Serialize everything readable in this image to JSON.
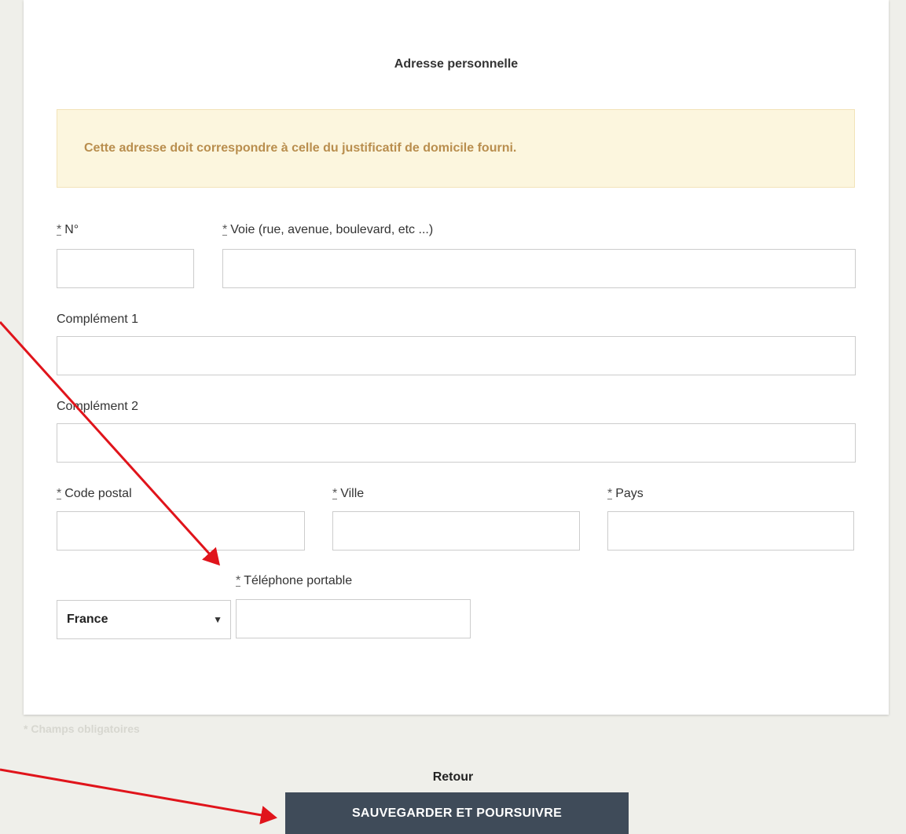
{
  "section": {
    "title": "Adresse personnelle",
    "alert_text": "Cette adresse doit correspondre à celle du justificatif de domicile fourni."
  },
  "fields": {
    "numero": {
      "label": "N°",
      "required": "*",
      "value": ""
    },
    "voie": {
      "label": "Voie (rue, avenue, boulevard, etc ...)",
      "required": "*",
      "value": ""
    },
    "complement1": {
      "label": "Complément 1",
      "value": ""
    },
    "complement2": {
      "label": "Complément 2",
      "value": ""
    },
    "code_postal": {
      "label": "Code postal",
      "required": "*",
      "value": ""
    },
    "ville": {
      "label": "Ville",
      "required": "*",
      "value": ""
    },
    "pays": {
      "label": "Pays",
      "required": "*",
      "value": ""
    },
    "telephone": {
      "label": "Téléphone portable",
      "required": "*",
      "value": ""
    },
    "country_code": {
      "selected": "France"
    }
  },
  "footer": {
    "required_note": "* Champs obligatoires",
    "back_label": "Retour",
    "submit_label": "SAUVEGARDER ET POURSUIVRE"
  },
  "colors": {
    "annotation_arrow": "#e0141b",
    "button_bg": "#3f4b59",
    "alert_bg": "#fcf6de",
    "alert_text": "#b98e4e"
  }
}
